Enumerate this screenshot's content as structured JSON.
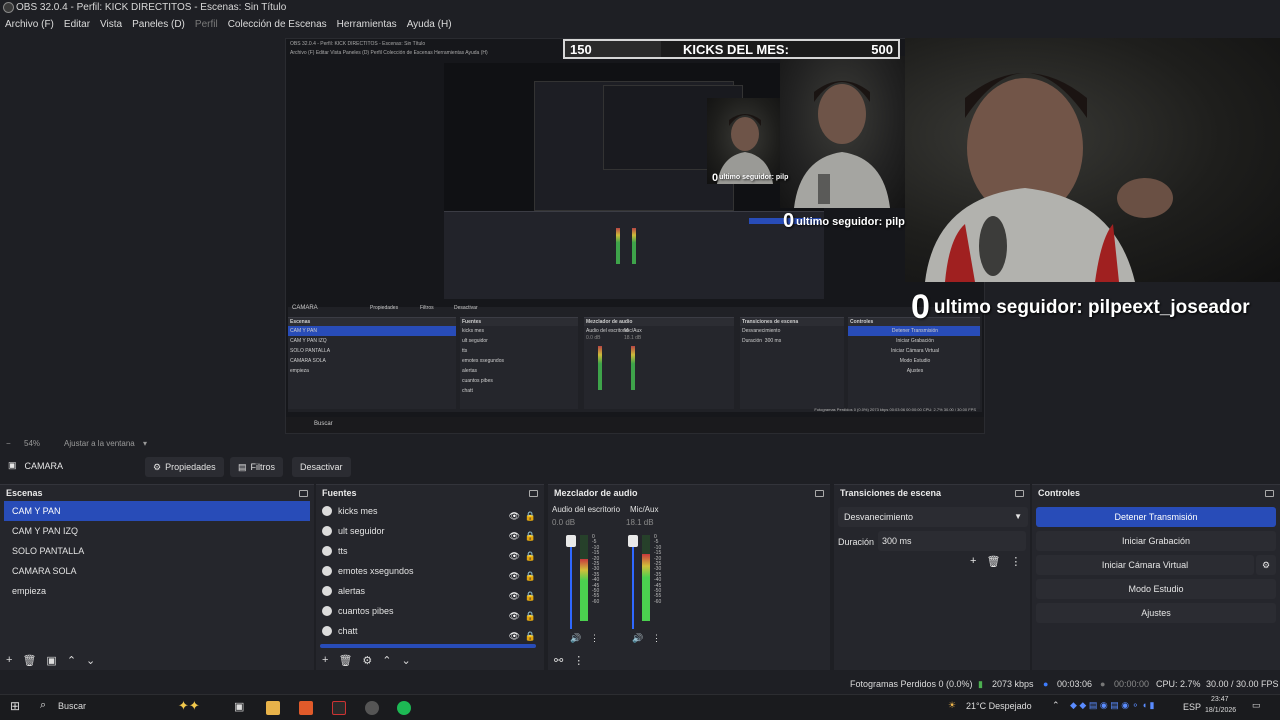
{
  "window": {
    "title": "OBS 32.0.4 - Perfil: KICK DIRECTITOS - Escenas: Sin Título"
  },
  "menu": [
    "Archivo (F)",
    "Editar",
    "Vista",
    "Paneles (D)",
    "Perfil",
    "Colección de Escenas",
    "Herramientas",
    "Ayuda (H)"
  ],
  "overlay": {
    "kicks_min": "150",
    "kicks_label": "KICKS DEL MES:",
    "kicks_max": "500",
    "follower_count": "0",
    "follower_text": "ultimo seguidor: pilpeext_joseador",
    "follower_text_mid": "ultimo seguidor: pilp",
    "follower_text_small": "ultimo seguidor: pilp"
  },
  "nested": {
    "title": "OBS 32.0.4 - Perfil: KICK DIRECTITOS - Escenas: Sin Título",
    "menu": "Archivo (F)   Editar   Vista   Paneles (D)   Perfil   Colección de Escenas   Herramientas   Ayuda (H)",
    "source": "CAMARA",
    "buttons": [
      "Propiedades",
      "Filtros",
      "Desactivar"
    ],
    "docks": [
      "Escenas",
      "Fuentes",
      "Mezclador de audio",
      "Transiciones de escena",
      "Controles"
    ],
    "scenes": [
      "CAM Y PAN",
      "CAM Y PAN IZQ",
      "SOLO PANTALLA",
      "CAMARA SOLA",
      "empieza"
    ],
    "sources": [
      "kicks mes",
      "ult seguidor",
      "tts",
      "emotes xsegundos",
      "alertas",
      "cuantos pibes",
      "chatt"
    ],
    "audio": [
      "Audio del escritorio",
      "Mic/Aux"
    ],
    "audio_db": [
      "0.0 dB",
      "18.1 dB"
    ],
    "transition": "Desvanecimiento",
    "duration_label": "Duración",
    "duration": "300 ms",
    "controls": [
      "Detener Transmisión",
      "Iniciar Grabación",
      "Iniciar Cámara Virtual",
      "Modo Estudio",
      "Ajustes"
    ],
    "status": "Fotogramas Perdidos 0 (0.0%)   2073 kbps   00:03:06   00:00:00   CPU: 2.7%   30.00 / 30.00 FPS",
    "search": "Buscar"
  },
  "zoom": {
    "percent": "54%",
    "fit_label": "Ajustar a la ventana"
  },
  "source_toolbar": {
    "source_name": "CAMARA",
    "properties": "Propiedades",
    "filters": "Filtros",
    "deactivate": "Desactivar"
  },
  "scenes": {
    "title": "Escenas",
    "items": [
      "CAM Y PAN",
      "CAM Y PAN IZQ",
      "SOLO PANTALLA",
      "CAMARA SOLA",
      "empieza"
    ],
    "active_index": 0
  },
  "sources": {
    "title": "Fuentes",
    "items": [
      "kicks mes",
      "ult seguidor",
      "tts",
      "emotes xsegundos",
      "alertas",
      "cuantos pibes",
      "chatt"
    ]
  },
  "mixer": {
    "title": "Mezclador de audio",
    "channels": [
      {
        "name": "Audio del escritorio",
        "db": "0.0 dB",
        "level": 0.72,
        "fader": 1.0
      },
      {
        "name": "Mic/Aux",
        "db": "18.1 dB",
        "level": 0.78,
        "fader": 1.0
      }
    ],
    "scale": [
      "0",
      "-5",
      "-10",
      "-15",
      "-20",
      "-25",
      "-30",
      "-35",
      "-40",
      "-45",
      "-50",
      "-55",
      "-60"
    ]
  },
  "transitions": {
    "title": "Transiciones de escena",
    "selected": "Desvanecimiento",
    "duration_label": "Duración",
    "duration": "300 ms"
  },
  "controls": {
    "title": "Controles",
    "stop_stream": "Detener Transmisión",
    "start_recording": "Iniciar Grabación",
    "virtual_cam": "Iniciar Cámara Virtual",
    "studio_mode": "Modo Estudio",
    "settings": "Ajustes"
  },
  "status": {
    "dropped": "Fotogramas Perdidos 0 (0.0%)",
    "bitrate": "2073 kbps",
    "stream_time": "00:03:06",
    "rec_time": "00:00:00",
    "cpu": "CPU: 2.7%",
    "fps": "30.00 / 30.00 FPS"
  },
  "taskbar": {
    "search": "Buscar",
    "weather": "21°C  Despejado",
    "lang": "ESP",
    "time": "23:47",
    "date": "18/1/2026"
  }
}
